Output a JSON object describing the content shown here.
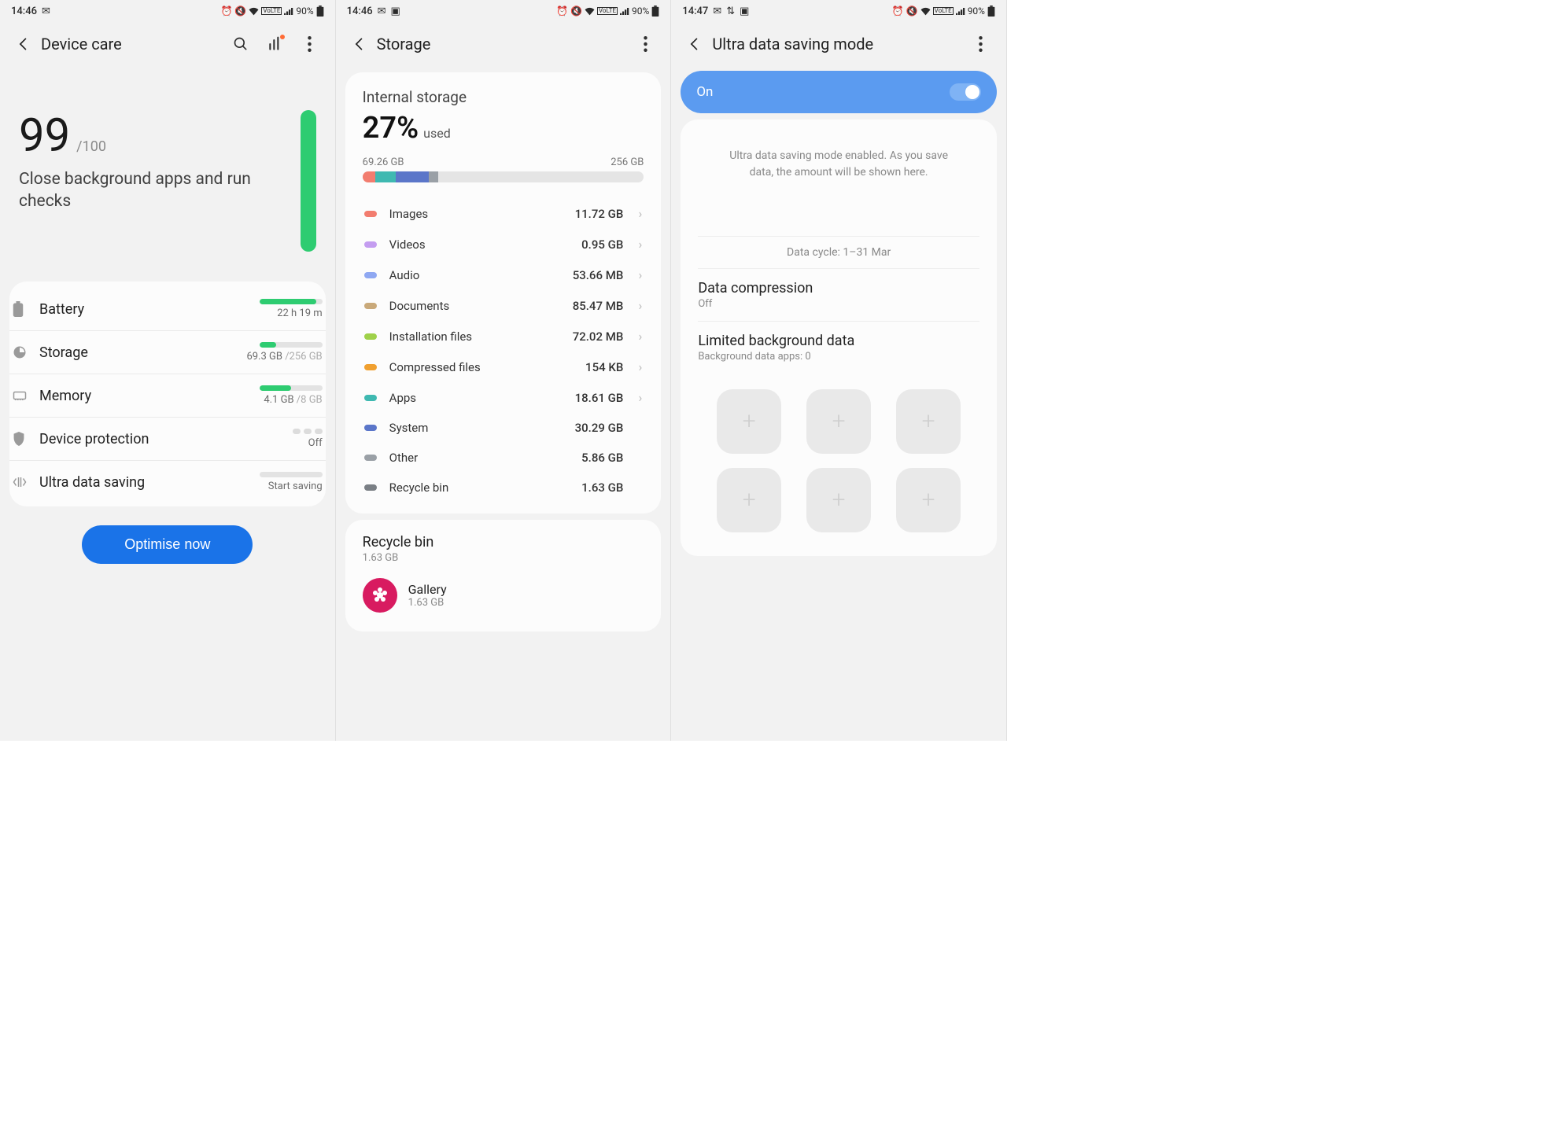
{
  "s1": {
    "status": {
      "time": "14:46",
      "battery_pct": "90%"
    },
    "title": "Device care",
    "score": "99",
    "score_max": "/100",
    "score_sub": "Close background apps and run checks",
    "rows": {
      "battery": {
        "label": "Battery",
        "value": "22 h 19 m",
        "bar_pct": 90
      },
      "storage": {
        "label": "Storage",
        "value": "69.3 GB",
        "value_muted": " /256 GB",
        "bar_pct": 27
      },
      "memory": {
        "label": "Memory",
        "value": "4.1 GB",
        "value_muted": " /8 GB",
        "bar_pct": 51
      },
      "protect": {
        "label": "Device protection",
        "value": "Off"
      },
      "uds": {
        "label": "Ultra data saving",
        "value": "Start saving"
      }
    },
    "cta": "Optimise now"
  },
  "s2": {
    "status": {
      "time": "14:46",
      "battery_pct": "90%"
    },
    "title": "Storage",
    "head": {
      "title": "Internal storage",
      "pct": "27%",
      "pct_label": "used",
      "used": "69.26 GB",
      "total": "256 GB"
    },
    "categories": [
      {
        "label": "Images",
        "value": "11.72 GB",
        "color": "#f27d6f",
        "nav": true
      },
      {
        "label": "Videos",
        "value": "0.95 GB",
        "color": "#c49df0",
        "nav": true
      },
      {
        "label": "Audio",
        "value": "53.66 MB",
        "color": "#8fa8f2",
        "nav": true
      },
      {
        "label": "Documents",
        "value": "85.47 MB",
        "color": "#c9a97a",
        "nav": true
      },
      {
        "label": "Installation files",
        "value": "72.02 MB",
        "color": "#9fd14a",
        "nav": true
      },
      {
        "label": "Compressed files",
        "value": "154 KB",
        "color": "#f0a030",
        "nav": true
      },
      {
        "label": "Apps",
        "value": "18.61 GB",
        "color": "#3fb9b1",
        "nav": true
      },
      {
        "label": "System",
        "value": "30.29 GB",
        "color": "#5b76c9",
        "nav": false
      },
      {
        "label": "Other",
        "value": "5.86 GB",
        "color": "#9aa0a6",
        "nav": false
      },
      {
        "label": "Recycle bin",
        "value": "1.63 GB",
        "color": "#7a7f85",
        "nav": false
      }
    ],
    "bar_segments": [
      {
        "color": "#f27d6f",
        "pct": 4.6
      },
      {
        "color": "#3fb9b1",
        "pct": 7.3
      },
      {
        "color": "#5b76c9",
        "pct": 11.8
      },
      {
        "color": "#9aa0a6",
        "pct": 3.3
      }
    ],
    "recycle": {
      "title": "Recycle bin",
      "size": "1.63 GB",
      "item_name": "Gallery",
      "item_size": "1.63 GB"
    }
  },
  "s3": {
    "status": {
      "time": "14:47",
      "battery_pct": "90%"
    },
    "title": "Ultra data saving mode",
    "toggle_label": "On",
    "info": "Ultra data saving mode enabled. As you save data, the amount will be shown here.",
    "cycle": "Data cycle: 1–31 Mar",
    "compression": {
      "label": "Data compression",
      "value": "Off"
    },
    "limited": {
      "label": "Limited background data",
      "value": "Background data apps: 0"
    }
  }
}
